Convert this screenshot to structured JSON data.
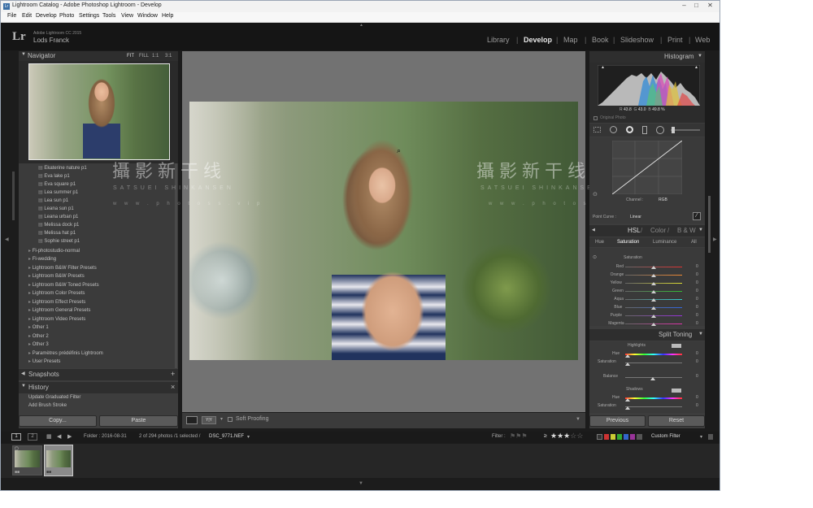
{
  "window": {
    "title": "Lightroom Catalog - Adobe Photoshop Lightroom - Develop",
    "min_glyph": "–",
    "max_glyph": "□",
    "close_glyph": "✕"
  },
  "menu": [
    "File",
    "Edit",
    "Develop",
    "Photo",
    "Settings",
    "Tools",
    "View",
    "Window",
    "Help"
  ],
  "identity": {
    "logo": "Lr",
    "version": "Adobe Lightroom CC 2015",
    "user": "Lods Franck"
  },
  "modules": [
    "Library",
    "Develop",
    "Map",
    "Book",
    "Slideshow",
    "Print",
    "Web"
  ],
  "navigator": {
    "title": "Navigator",
    "zoom": [
      "FIT",
      "FILL",
      "1:1",
      "3:1"
    ]
  },
  "presets": {
    "items": [
      "Ekaterine nature p1",
      "Eva lake p1",
      "Eva square p1",
      "Lea summer p1",
      "Lea sun p1",
      "Leana sun p1",
      "Leana urban p1",
      "Melissa dock p1",
      "Melissa hat p1",
      "Sophie street p1"
    ],
    "folders": [
      "Fl-photostudio-normal",
      "Fl-wedding",
      "Lightroom B&W Filter Presets",
      "Lightroom B&W Presets",
      "Lightroom B&W Toned Presets",
      "Lightroom Color Presets",
      "Lightroom Effect Presets",
      "Lightroom General Presets",
      "Lightroom Video Presets",
      "Other 1",
      "Other 2",
      "Other 3",
      "Paramètres prédéfinis Lightroom",
      "User Presets"
    ]
  },
  "snapshots": {
    "title": "Snapshots",
    "add": "+"
  },
  "history": {
    "title": "History",
    "close": "×",
    "items": [
      "Update Graduated Filter",
      "Add Brush Stroke"
    ]
  },
  "left_buttons": {
    "copy": "Copy...",
    "paste": "Paste"
  },
  "watermark": {
    "main": "攝影新干线",
    "sub": "SATSUEI SHINKANSEN",
    "url": "w w w . p h o t o s s . v i p"
  },
  "toolbar": {
    "soft_proofing": "Soft Proofing"
  },
  "histogram": {
    "title": "Histogram",
    "r_label": "R",
    "r": "43.8",
    "g_label": "G",
    "g": "43.0",
    "b_label": "B",
    "b": "49.8 %",
    "original_photo": "Original Photo"
  },
  "tone_curve": {
    "channel_label": "Channel :",
    "channel": "RGB",
    "point_curve_label": "Point Curve :",
    "point_curve": "Linear"
  },
  "hsl": {
    "title_hsl": "HSL",
    "title_color": "Color",
    "title_bw": "B & W",
    "tabs": [
      "Hue",
      "Saturation",
      "Luminance",
      "All"
    ],
    "section": "Saturation",
    "rows": [
      {
        "label": "Red",
        "value": "0"
      },
      {
        "label": "Orange",
        "value": "0"
      },
      {
        "label": "Yellow",
        "value": "0"
      },
      {
        "label": "Green",
        "value": "0"
      },
      {
        "label": "Aqua",
        "value": "0"
      },
      {
        "label": "Blue",
        "value": "0"
      },
      {
        "label": "Purple",
        "value": "0"
      },
      {
        "label": "Magenta",
        "value": "0"
      }
    ]
  },
  "split_toning": {
    "title": "Split Toning",
    "highlights": "Highlights",
    "hue": "Hue",
    "saturation": "Saturation",
    "balance": "Balance",
    "shadows": "Shadows",
    "hl_hue": "0",
    "hl_sat": "0",
    "bal": "0",
    "sh_hue": "0",
    "sh_sat": "0"
  },
  "right_buttons": {
    "previous": "Previous",
    "reset": "Reset"
  },
  "filmstrip": {
    "page1": "1",
    "page2": "2",
    "folder": "Folder : 2016-08-31",
    "count": "2 of 294 photos /1 selected /",
    "file": "DSC_9771.NEF",
    "filter_label": "Filter :",
    "gte": "≥",
    "custom_filter": "Custom Filter"
  },
  "colors": {
    "accent": "#e0e0e0",
    "panel": "#3d3d3d",
    "bg": "#1c1c1c",
    "center": "#727272"
  }
}
